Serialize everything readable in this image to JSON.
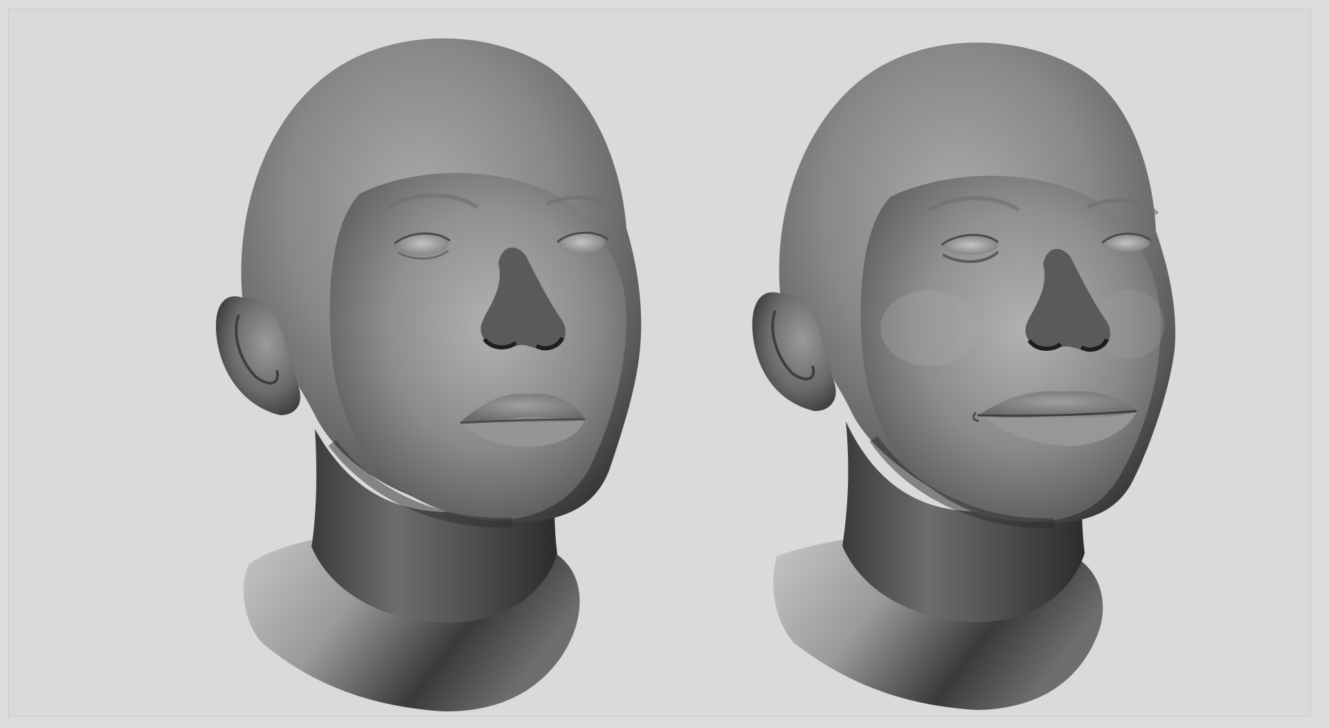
{
  "scene": {
    "background_color": "#dadada",
    "frame_color": "#c9c9c9",
    "clay_color": "#8a8a8a",
    "models": [
      {
        "name": "neutral-expression-head",
        "icon": "sculpted-head"
      },
      {
        "name": "smiling-expression-head",
        "icon": "sculpted-head"
      }
    ]
  }
}
